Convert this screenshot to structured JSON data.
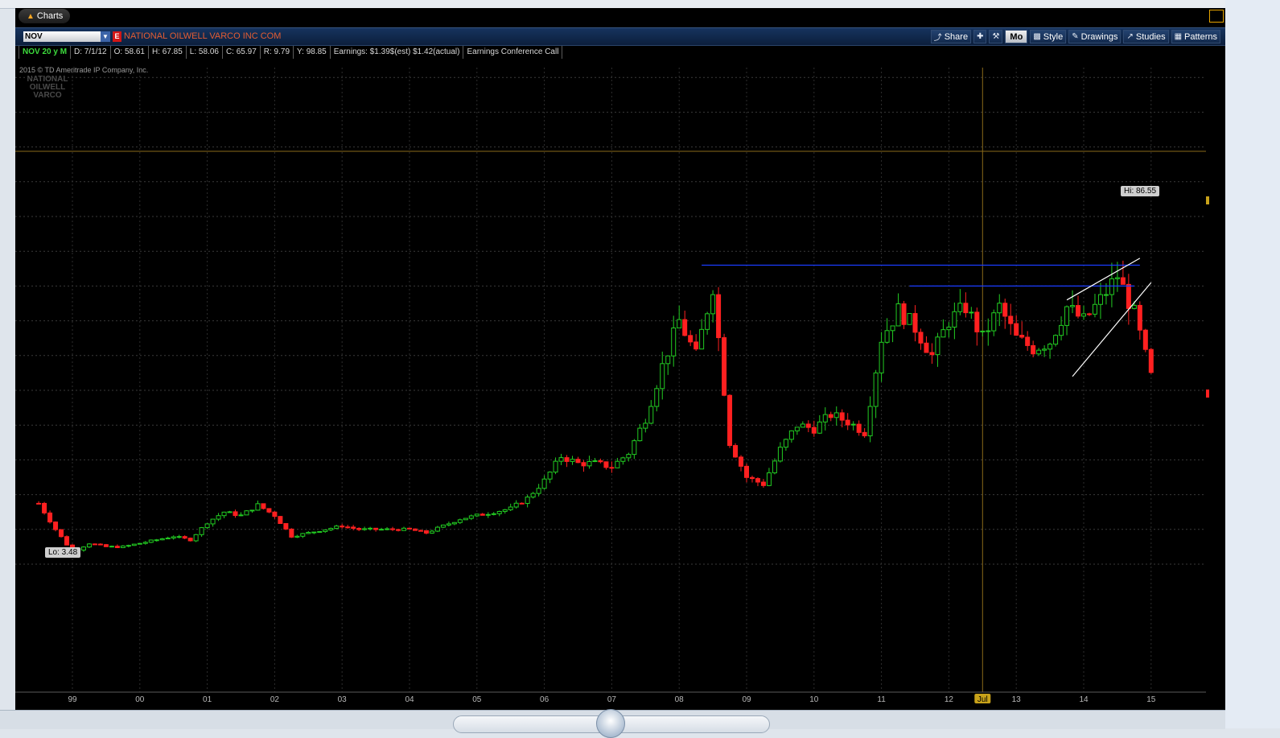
{
  "window": {
    "title": ""
  },
  "tab": {
    "label": "Charts"
  },
  "symbol": {
    "ticker": "NOV",
    "company": "NATIONAL OILWELL VARCO INC COM"
  },
  "toolbar": {
    "share": "Share",
    "mode": "Mo",
    "style": "Style",
    "drawings": "Drawings",
    "studies": "Studies",
    "patterns": "Patterns"
  },
  "info": {
    "period": "NOV 20 y M",
    "date": "D: 7/1/12",
    "open": "O: 58.61",
    "high": "H: 67.85",
    "low": "L: 58.06",
    "close": "C: 65.97",
    "range": "R: 9.79",
    "y": "Y: 98.85",
    "earnings": "Earnings: $1.39$(est) $1.42(actual)",
    "event": "Earnings Conference Call"
  },
  "watermark": {
    "copyright": "2015 © TD Ameritrade IP Company, Inc.",
    "logo": "NATIONAL OILWELL VARCO"
  },
  "annotations": {
    "low": "Lo: 3.48",
    "high": "Hi: 86.55",
    "cursor_label": "Jul"
  },
  "colors": {
    "up": "#22cc22",
    "down": "#ff2020",
    "grid": "#3a3a3a",
    "background": "#000000"
  },
  "chart_data": {
    "type": "candlestick",
    "x_tick_labels": [
      "99",
      "00",
      "01",
      "02",
      "03",
      "04",
      "05",
      "06",
      "07",
      "08",
      "09",
      "10",
      "11",
      "12",
      "Jul",
      "13",
      "14",
      "15"
    ],
    "ylim": [
      0,
      100
    ],
    "grid": true,
    "annotations": [
      {
        "label": "Lo: 3.48",
        "value": 3.48
      },
      {
        "label": "Hi: 86.55",
        "value": 86.55
      }
    ],
    "trendlines": [
      {
        "color": "blue",
        "from": [
          "2008-05",
          86
        ],
        "to": [
          "2014-11",
          86
        ]
      },
      {
        "color": "blue",
        "from": [
          "2011-06",
          80
        ],
        "to": [
          "2014-10",
          80
        ]
      },
      {
        "color": "white",
        "from": [
          "2013-10",
          76
        ],
        "to": [
          "2014-11",
          88
        ]
      },
      {
        "color": "white",
        "from": [
          "2013-11",
          54
        ],
        "to": [
          "2015-01",
          81
        ]
      }
    ],
    "close_path": [
      [
        "1998-07",
        17.5
      ],
      [
        "1998-10",
        10
      ],
      [
        "1999-01",
        3.5
      ],
      [
        "1999-04",
        6
      ],
      [
        "1999-07",
        5
      ],
      [
        "1999-10",
        5
      ],
      [
        "2000-01",
        6
      ],
      [
        "2000-04",
        7
      ],
      [
        "2000-07",
        8
      ],
      [
        "2000-10",
        7
      ],
      [
        "2001-01",
        12
      ],
      [
        "2001-04",
        15
      ],
      [
        "2001-07",
        14
      ],
      [
        "2001-10",
        17
      ],
      [
        "2002-01",
        14
      ],
      [
        "2002-04",
        8
      ],
      [
        "2002-07",
        9
      ],
      [
        "2002-10",
        10
      ],
      [
        "2003-01",
        11
      ],
      [
        "2003-04",
        10
      ],
      [
        "2003-07",
        10
      ],
      [
        "2003-10",
        10
      ],
      [
        "2004-01",
        10
      ],
      [
        "2004-04",
        9
      ],
      [
        "2004-07",
        11
      ],
      [
        "2004-10",
        13
      ],
      [
        "2005-01",
        14
      ],
      [
        "2005-04",
        15
      ],
      [
        "2005-07",
        16
      ],
      [
        "2005-10",
        19
      ],
      [
        "2006-01",
        24
      ],
      [
        "2006-04",
        31
      ],
      [
        "2006-07",
        29
      ],
      [
        "2006-10",
        29
      ],
      [
        "2007-01",
        28
      ],
      [
        "2007-04",
        32
      ],
      [
        "2007-07",
        42
      ],
      [
        "2007-10",
        57
      ],
      [
        "2008-01",
        70
      ],
      [
        "2008-04",
        60
      ],
      [
        "2008-07",
        80
      ],
      [
        "2008-10",
        35
      ],
      [
        "2009-01",
        25
      ],
      [
        "2009-04",
        23
      ],
      [
        "2009-07",
        33
      ],
      [
        "2009-10",
        40
      ],
      [
        "2010-01",
        39
      ],
      [
        "2010-04",
        43
      ],
      [
        "2010-07",
        41
      ],
      [
        "2010-10",
        38
      ],
      [
        "2011-01",
        65
      ],
      [
        "2011-04",
        73
      ],
      [
        "2011-07",
        68
      ],
      [
        "2011-10",
        60
      ],
      [
        "2012-01",
        70
      ],
      [
        "2012-04",
        74
      ],
      [
        "2012-07",
        65
      ],
      [
        "2012-10",
        74
      ],
      [
        "2013-01",
        65
      ],
      [
        "2013-04",
        62
      ],
      [
        "2013-07",
        64
      ],
      [
        "2013-10",
        74
      ],
      [
        "2014-01",
        70
      ],
      [
        "2014-04",
        76
      ],
      [
        "2014-07",
        83
      ],
      [
        "2014-10",
        72
      ],
      [
        "2015-01",
        54
      ]
    ]
  }
}
